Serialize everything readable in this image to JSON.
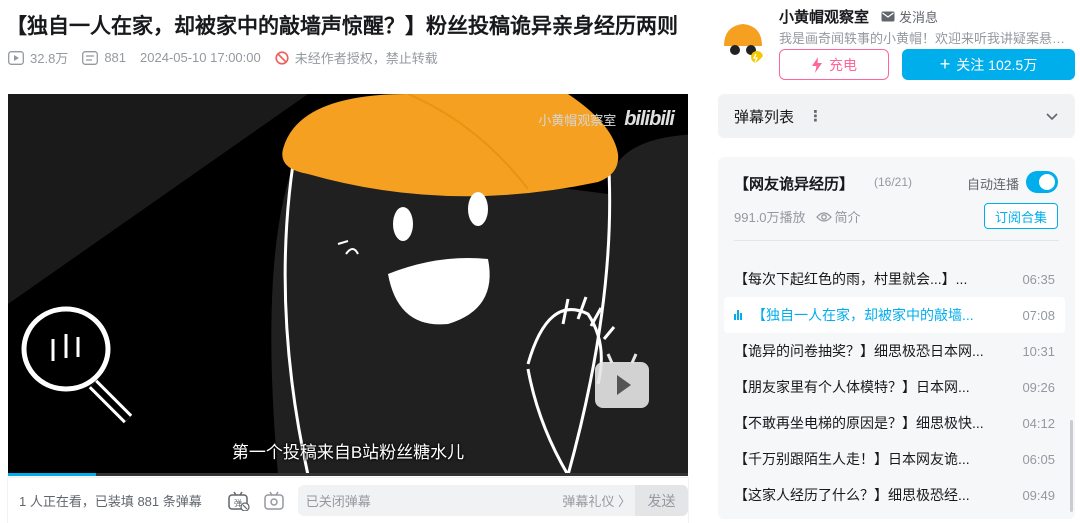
{
  "video": {
    "title": "【独自一人在家，却被家中的敲墙声惊醒？】粉丝投稿诡异亲身经历两则",
    "plays": "32.8万",
    "danmaku_count": "881",
    "publish_time": "2024-05-10 17:00:00",
    "copyright_notice": "未经作者授权，禁止转载",
    "watermark_channel": "小黄帽观察室",
    "watermark_logo": "bilibili",
    "subtitle": "第一个投稿来自B站粉丝糖水儿",
    "progress_fraction": 0.13
  },
  "danmaku_bar": {
    "viewers_text": "1 人正在看，已装填 881 条弹幕",
    "input_placeholder": "已关闭弹幕",
    "etiquette_label": "弹幕礼仪 〉",
    "send_label": "发送"
  },
  "uploader": {
    "name": "小黄帽观察室",
    "message_label": "发消息",
    "description": "我是画奇闻轶事的小黄帽！欢迎来听我讲疑案悬…",
    "charge_label": "充电",
    "follow_label": "关注 102.5万"
  },
  "danmaku_list": {
    "label": "弹幕列表"
  },
  "collection": {
    "title": "【网友诡异经历】",
    "count": "(16/21)",
    "autoplay_label": "自动连播",
    "autoplay_on": true,
    "plays": "991.0万播放",
    "intro_label": "简介",
    "subscribe_label": "订阅合集",
    "episodes": [
      {
        "title": "【每次下起红色的雨，村里就会...】...",
        "duration": "06:35",
        "active": false
      },
      {
        "title": "【独自一人在家，却被家中的敲墙...",
        "duration": "07:08",
        "active": true
      },
      {
        "title": "【诡异的问卷抽奖？】细思极恐日本网...",
        "duration": "10:31",
        "active": false
      },
      {
        "title": "【朋友家里有个人体模特？】日本网...",
        "duration": "09:26",
        "active": false
      },
      {
        "title": "【不敢再坐电梯的原因是？】细思极快...",
        "duration": "04:12",
        "active": false
      },
      {
        "title": "【千万别跟陌生人走！】日本网友诡...",
        "duration": "06:05",
        "active": false
      },
      {
        "title": "【这家人经历了什么？】细思极恐经...",
        "duration": "09:49",
        "active": false
      }
    ]
  },
  "colors": {
    "accent": "#00aeec",
    "charge_pink": "#ff6699",
    "hat_orange": "#f5a020"
  }
}
